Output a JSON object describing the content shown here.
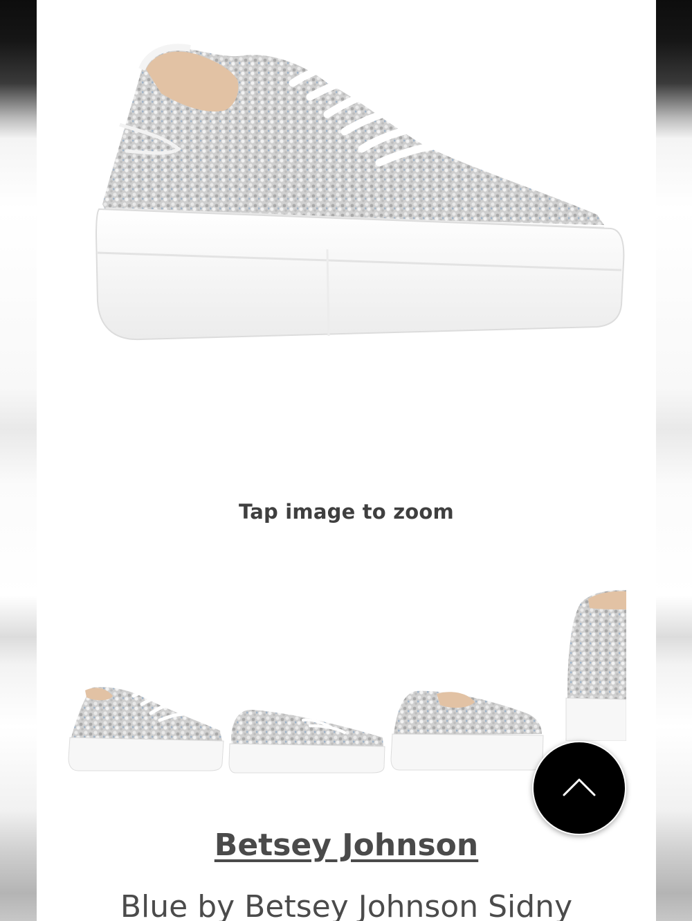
{
  "gallery": {
    "main_image_alt": "Rhinestone embellished platform sneaker",
    "zoom_hint": "Tap image to zoom",
    "thumbnails": [
      {
        "view": "three-quarter view"
      },
      {
        "view": "side view"
      },
      {
        "view": "back three-quarter view"
      },
      {
        "view": "detail view (partially visible)"
      }
    ]
  },
  "scroll_top": {
    "icon": "chevron-up-icon"
  },
  "product": {
    "brand": "Betsey Johnson",
    "title": "Blue by Betsey Johnson Sidny"
  },
  "colors": {
    "accent_button": "#000000",
    "text_gray": "#4a4a4a"
  }
}
